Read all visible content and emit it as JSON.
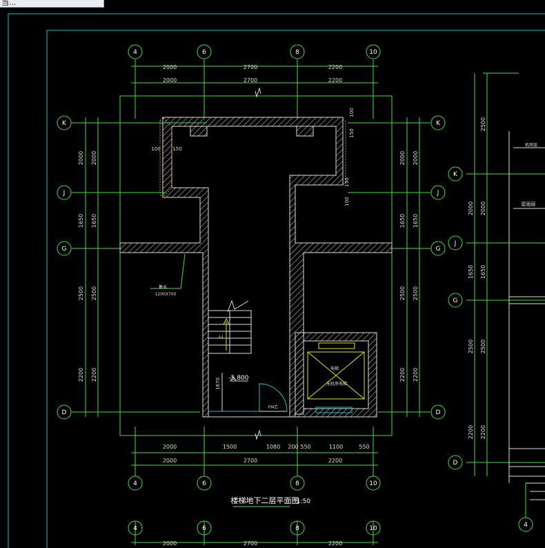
{
  "window": {
    "title": "当..."
  },
  "main_plan": {
    "title": "楼梯地下二层平面图",
    "scale": "1:50",
    "axis_columns": [
      "4",
      "6",
      "8",
      "10"
    ],
    "axis_rows": [
      "K",
      "J",
      "G",
      "D"
    ],
    "top_dims_row1": [
      "2000",
      "2700",
      "2200"
    ],
    "top_dims_row2": [
      "2000",
      "2700",
      "2200"
    ],
    "bottom_dims_row1": [
      "2000",
      "1500",
      "1080",
      "200",
      "550",
      "1100",
      "550"
    ],
    "bottom_dims_row2": [
      "2000",
      "2700",
      "2200"
    ],
    "side_dims_outer": [
      "2000",
      "1650",
      "2500",
      "2200"
    ],
    "side_dims_inner": [
      "2000",
      "1650",
      "2500",
      "2200"
    ],
    "wall_dims": [
      "100",
      "150",
      "100",
      "150",
      "150",
      "100"
    ],
    "level": "-5.800",
    "level_dim": "1670",
    "door_tag": "FM乙",
    "stair_up": "上",
    "pit_label": "集水",
    "pit_size": "1200X700",
    "elevator_text_1": "电梯",
    "elevator_text_2": "无机房电梯"
  },
  "bottom_plan": {
    "axis_columns": [
      "4",
      "6",
      "8",
      "10"
    ],
    "dims": [
      "2000",
      "2700",
      "2200"
    ]
  },
  "right_plan": {
    "axis_rows": [
      "K",
      "J",
      "G",
      "D"
    ],
    "axis_column": "4",
    "dims_a": [
      "2000",
      "1650",
      "2500",
      "2200"
    ],
    "dims_b": [
      "2000",
      "1650",
      "2500",
      "2200"
    ],
    "top_dim": "2500",
    "label_1": "机房层",
    "label_2": "屋面层"
  }
}
